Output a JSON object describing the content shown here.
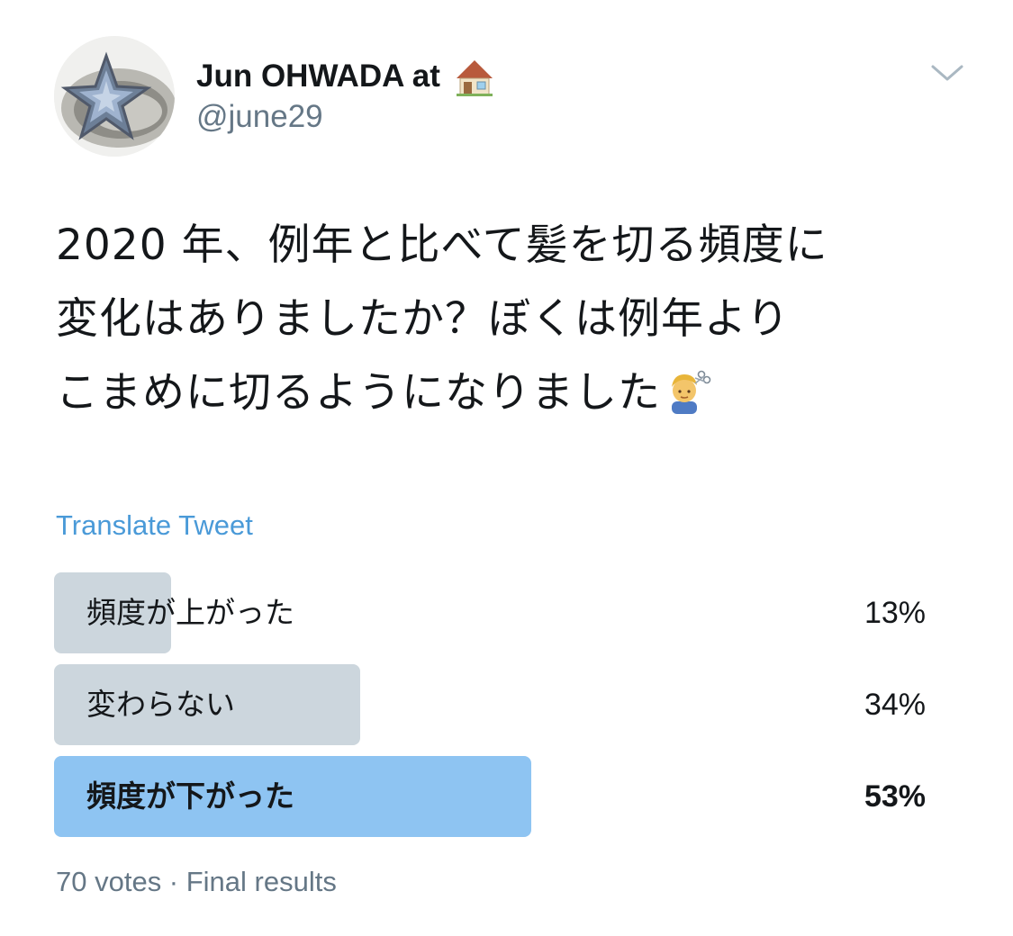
{
  "author": {
    "display_name": "Jun OHWADA at",
    "name_icon": "house-icon",
    "handle": "@june29",
    "avatar_icon": "star-ring-avatar"
  },
  "menu": {
    "icon": "chevron-down-icon"
  },
  "tweet": {
    "lines": [
      "2020 年、例年と比べて髪を切る頻度に",
      "変化はありましたか？ぼくは例年より",
      "こまめに切るようになりました"
    ],
    "trailing_icon": "haircut-icon"
  },
  "translate_label": "Translate Tweet",
  "poll": {
    "options": [
      {
        "label": "頻度が上がった",
        "percent_label": "13%",
        "percent": 13,
        "winner": false
      },
      {
        "label": "変わらない",
        "percent_label": "34%",
        "percent": 34,
        "winner": false
      },
      {
        "label": "頻度が下がった",
        "percent_label": "53%",
        "percent": 53,
        "winner": true
      }
    ],
    "footer": "70 votes · Final results"
  },
  "colors": {
    "bar": "#ccd6dd",
    "winner_bar": "#8ec4f2",
    "link": "#4a9ad8",
    "secondary_text": "#657786"
  }
}
